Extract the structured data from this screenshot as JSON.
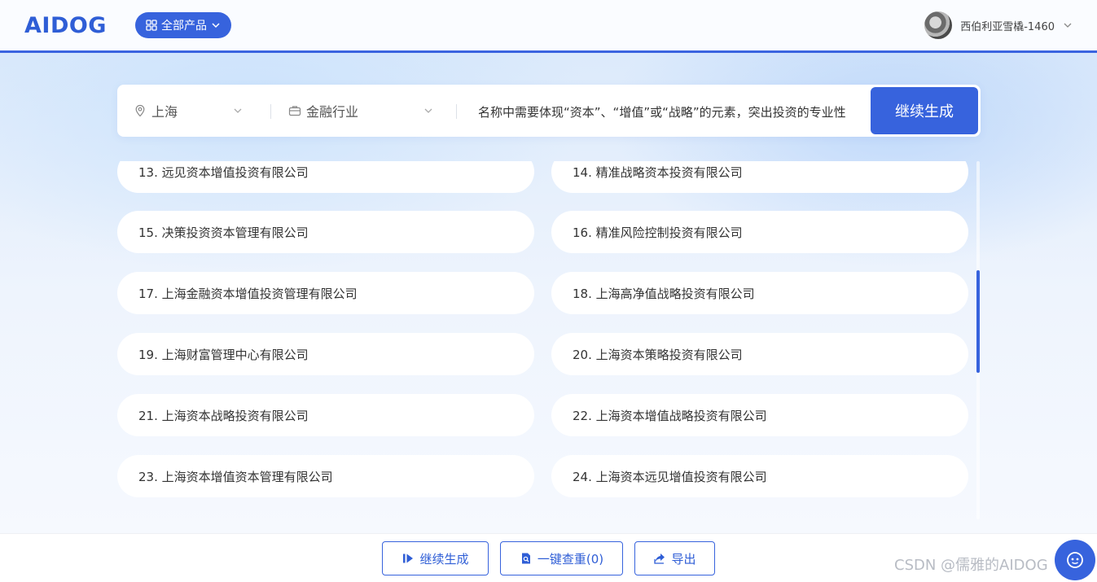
{
  "header": {
    "logo_text": "AIDOG",
    "products_label": "全部产品",
    "user_name": "西伯利亚雪橇-1460"
  },
  "search": {
    "location": "上海",
    "industry": "金融行业",
    "prompt_value": "名称中需要体现“资本”、“增值”或“战略”的元素，突出投资的专业性",
    "generate_label": "继续生成"
  },
  "results": [
    "13. 远见资本增值投资有限公司",
    "14. 精准战略资本投资有限公司",
    "15. 决策投资资本管理有限公司",
    "16. 精准风险控制投资有限公司",
    "17. 上海金融资本增值投资管理有限公司",
    "18. 上海高净值战略投资有限公司",
    "19. 上海财富管理中心有限公司",
    "20. 上海资本策略投资有限公司",
    "21. 上海资本战略投资有限公司",
    "22. 上海资本增值战略投资有限公司",
    "23. 上海资本增值资本管理有限公司",
    "24. 上海资本远见增值投资有限公司"
  ],
  "footer": {
    "continue_label": "继续生成",
    "check_label": "一键查重(0)",
    "export_label": "导出"
  },
  "watermark": "CSDN @儒雅的AIDOG",
  "colors": {
    "primary": "#3763dd",
    "header_line": "#3b64e0"
  }
}
